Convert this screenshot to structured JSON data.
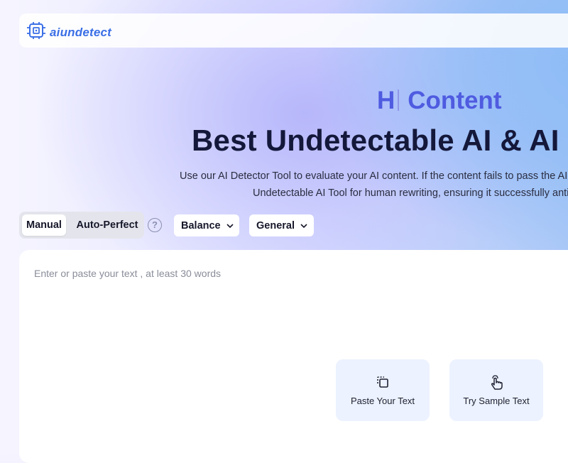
{
  "header": {
    "logo_text": "aiundetect",
    "logo_icon": "chip-icon"
  },
  "hero": {
    "typing_prefix": "H",
    "typing_word": "Content",
    "title": "Best Undetectable AI & AI",
    "subtitle_line1": "Use our AI Detector Tool to evaluate your AI content. If the content fails to pass the AI",
    "subtitle_line2": "Undetectable AI Tool for human rewriting, ensuring it successfully anti"
  },
  "controls": {
    "modes": [
      "Manual",
      "Auto-Perfect"
    ],
    "selected_mode": "Manual",
    "help_icon": "question-circle-icon",
    "help_glyph": "?",
    "strength_dropdown": "Balance",
    "purpose_dropdown": "General"
  },
  "editor": {
    "placeholder": "Enter or paste your text , at least 30 words",
    "paste_button": {
      "label": "Paste Your Text",
      "icon": "paste-icon"
    },
    "sample_button": {
      "label": "Try Sample Text",
      "icon": "hand-pointer-icon"
    }
  },
  "colors": {
    "accent": "#3b6fe6",
    "hero_word": "#4f5be0",
    "title": "#14183a"
  }
}
